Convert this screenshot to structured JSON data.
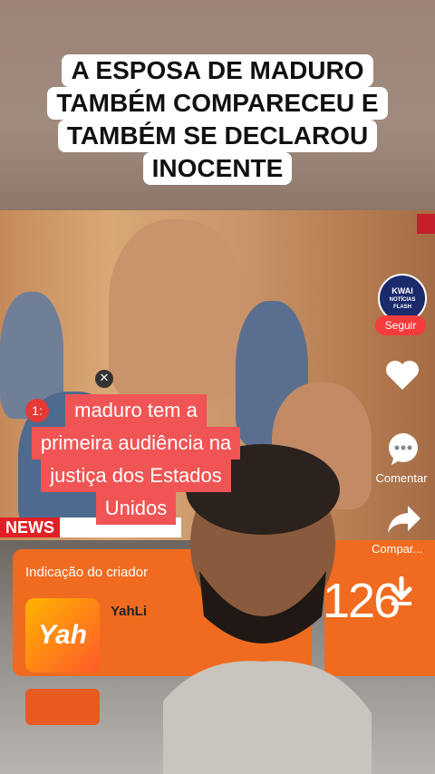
{
  "headline": {
    "lines": [
      "A ESPOSA DE MADURO",
      "TAMBÉM COMPARECEU E",
      "TAMBÉM SE DECLAROU",
      "INOCENTE"
    ]
  },
  "caption": {
    "lines": [
      "maduro tem a",
      "primeira audiência na",
      "justiça dos Estados",
      "Unidos"
    ]
  },
  "news_ticker": {
    "label": "NEWS",
    "badge": "1:"
  },
  "creator_card": {
    "title": "Indicação do criador",
    "app_tile_text": "Yah",
    "app_name": "YahLi"
  },
  "right_card": {
    "share_label": "Compar...",
    "number": "126"
  },
  "side_rail": {
    "kwai_badge_top": "KWAI",
    "kwai_badge_sub": "NOTÍCIAS FLASH",
    "follow_label": "Seguir",
    "comment_label": "Comentar"
  },
  "icons": [
    "heart-icon",
    "comment-icon",
    "share-icon",
    "close-icon",
    "download-icon"
  ],
  "colors": {
    "accent_red": "#f05454",
    "kwai_orange": "#f06b1f",
    "follow_red": "#f53b3b"
  }
}
